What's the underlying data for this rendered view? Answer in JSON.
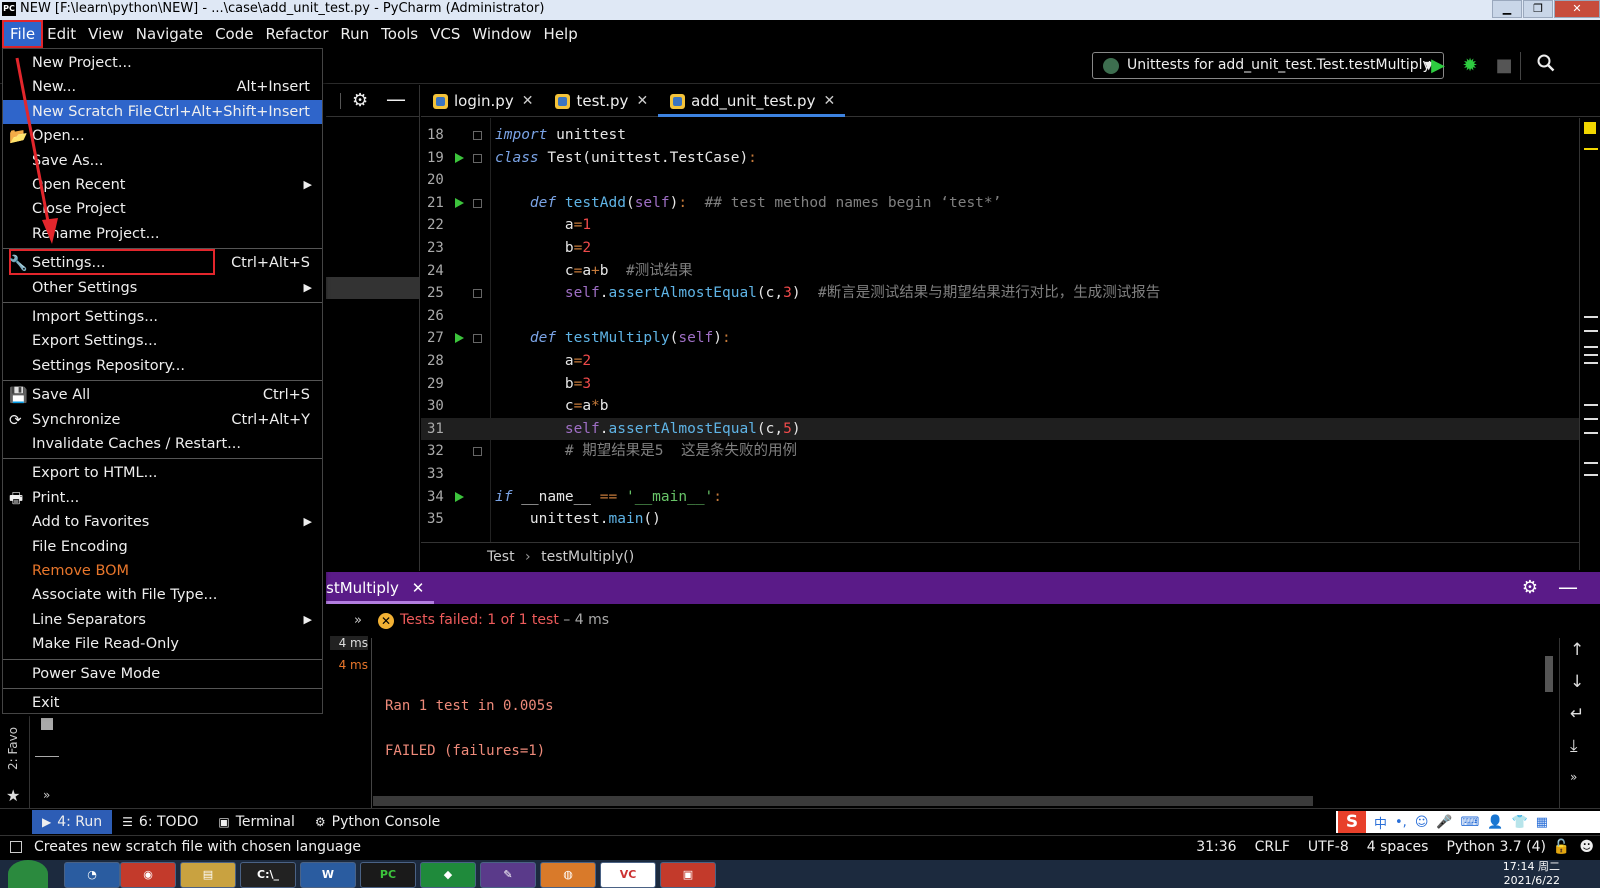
{
  "window": {
    "title": "NEW [F:\\learn\\python\\NEW] - ...\\case\\add_unit_test.py - PyCharm (Administrator)",
    "app_icon": "PC"
  },
  "menubar": [
    "File",
    "Edit",
    "View",
    "Navigate",
    "Code",
    "Refactor",
    "Run",
    "Tools",
    "VCS",
    "Window",
    "Help"
  ],
  "toolbar": {
    "run_config": "Unittests for add_unit_test.Test.testMultiply"
  },
  "tabs": [
    {
      "label": "login.py",
      "active": false
    },
    {
      "label": "test.py",
      "active": false
    },
    {
      "label": "add_unit_test.py",
      "active": true
    }
  ],
  "editor": {
    "lines": [
      {
        "n": "18",
        "html": "<span class=\"kw\">import</span> unittest",
        "run": false,
        "fold": true
      },
      {
        "n": "19",
        "html": "<span class=\"kw\">class</span> Test(unittest.TestCase)<span class=\"op\">:</span>",
        "run": true,
        "fold": true
      },
      {
        "n": "20",
        "html": "",
        "run": false,
        "fold": false
      },
      {
        "n": "21",
        "html": "    <span class=\"kw\">def</span> <span class=\"fn\">testAdd</span>(<span class=\"self\">self</span>)<span class=\"op\">:</span>  <span class=\"cmt\">## test method names begin ‘test*’</span>",
        "run": true,
        "fold": true
      },
      {
        "n": "22",
        "html": "        a<span class=\"op\">=</span><span class=\"num\">1</span>",
        "run": false,
        "fold": false
      },
      {
        "n": "23",
        "html": "        b<span class=\"op\">=</span><span class=\"num\">2</span>",
        "run": false,
        "fold": false
      },
      {
        "n": "24",
        "html": "        c<span class=\"op\">=</span>a<span class=\"op\">+</span>b  <span class=\"cmt\">#测试结果</span>",
        "run": false,
        "fold": false
      },
      {
        "n": "25",
        "html": "        <span class=\"self\">self</span>.<span class=\"fn\">assertAlmostEqual</span>(c,<span class=\"num\">3</span>)  <span class=\"cmt\">#断言是测试结果与期望结果进行对比，生成测试报告</span>",
        "run": false,
        "fold": true
      },
      {
        "n": "26",
        "html": "",
        "run": false,
        "fold": false
      },
      {
        "n": "27",
        "html": "    <span class=\"kw\">def</span> <span class=\"fn\">testMultiply</span>(<span class=\"self\">self</span>)<span class=\"op\">:</span>",
        "run": true,
        "fold": true
      },
      {
        "n": "28",
        "html": "        a<span class=\"op\">=</span><span class=\"num\">2</span>",
        "run": false,
        "fold": false
      },
      {
        "n": "29",
        "html": "        b<span class=\"op\">=</span><span class=\"num\">3</span>",
        "run": false,
        "fold": false
      },
      {
        "n": "30",
        "html": "        c<span class=\"op\">=</span>a<span class=\"op\">*</span>b",
        "run": false,
        "fold": false
      },
      {
        "n": "31",
        "html": "        <span class=\"self\">self</span>.<span class=\"fn\">assertAlmostEqual</span>(c,<span class=\"num\">5</span>)",
        "run": false,
        "fold": false,
        "current": true
      },
      {
        "n": "32",
        "html": "        <span class=\"cmt\"># 期望结果是5  这是条失败的用例</span>",
        "run": false,
        "fold": true
      },
      {
        "n": "33",
        "html": "",
        "run": false,
        "fold": false
      },
      {
        "n": "34",
        "html": "<span class=\"kw\">if</span> __name__ <span class=\"op\">==</span> <span class=\"str\">'__main__'</span><span class=\"op\">:</span>",
        "run": true,
        "fold": false
      },
      {
        "n": "35",
        "html": "    unittest.<span class=\"fn\">main</span>()",
        "run": false,
        "fold": false
      }
    ],
    "breadcrumb": [
      "Test",
      "testMultiply()"
    ]
  },
  "run_panel": {
    "tab_label": "stMultiply",
    "status": "Tests failed: 1 of 1 test",
    "duration": "– 4 ms",
    "tree_times": [
      "4 ms",
      "4 ms"
    ],
    "console": [
      "Ran 1 test in 0.005s",
      "FAILED (failures=1)"
    ]
  },
  "favorites_label": "2: Favo",
  "tool_buttons": [
    {
      "label": "4: Run",
      "icon": "▶",
      "active": true
    },
    {
      "label": "6: TODO",
      "icon": "☰",
      "active": false
    },
    {
      "label": "Terminal",
      "icon": "▣",
      "active": false
    },
    {
      "label": "Python Console",
      "icon": "⚙",
      "active": false
    }
  ],
  "statusbar": {
    "message": "Creates new scratch file with chosen language",
    "position": "31:36",
    "line_sep": "CRLF",
    "encoding": "UTF-8",
    "indent": "4 spaces",
    "interpreter": "Python 3.7 (4)"
  },
  "taskbar": {
    "time": "17:14 周二",
    "date": "2021/6/22"
  },
  "file_menu": {
    "groups": [
      [
        {
          "label": "New Project...",
          "shortcut": ""
        },
        {
          "label": "New...",
          "shortcut": "Alt+Insert"
        },
        {
          "label": "New Scratch File",
          "shortcut": "Ctrl+Alt+Shift+Insert",
          "highlight": true
        },
        {
          "label": "Open...",
          "shortcut": "",
          "icon": "📂"
        },
        {
          "label": "Save As...",
          "shortcut": ""
        },
        {
          "label": "Open Recent",
          "shortcut": "",
          "submenu": true
        },
        {
          "label": "Close Project",
          "shortcut": ""
        },
        {
          "label": "Rename Project...",
          "shortcut": ""
        }
      ],
      [
        {
          "label": "Settings...",
          "shortcut": "Ctrl+Alt+S",
          "icon": "🔧"
        },
        {
          "label": "Other Settings",
          "shortcut": "",
          "submenu": true
        }
      ],
      [
        {
          "label": "Import Settings...",
          "shortcut": ""
        },
        {
          "label": "Export Settings...",
          "shortcut": ""
        },
        {
          "label": "Settings Repository...",
          "shortcut": ""
        }
      ],
      [
        {
          "label": "Save All",
          "shortcut": "Ctrl+S",
          "icon": "💾"
        },
        {
          "label": "Synchronize",
          "shortcut": "Ctrl+Alt+Y",
          "icon": "⟳"
        },
        {
          "label": "Invalidate Caches / Restart...",
          "shortcut": ""
        }
      ],
      [
        {
          "label": "Export to HTML...",
          "shortcut": ""
        },
        {
          "label": "Print...",
          "shortcut": "",
          "icon": "🖶"
        },
        {
          "label": "Add to Favorites",
          "shortcut": "",
          "submenu": true
        },
        {
          "label": "File Encoding",
          "shortcut": ""
        },
        {
          "label": "Remove BOM",
          "shortcut": "",
          "orange": true
        },
        {
          "label": "Associate with File Type...",
          "shortcut": ""
        },
        {
          "label": "Line Separators",
          "shortcut": "",
          "submenu": true
        },
        {
          "label": "Make File Read-Only",
          "shortcut": ""
        }
      ],
      [
        {
          "label": "Power Save Mode",
          "shortcut": ""
        }
      ],
      [
        {
          "label": "Exit",
          "shortcut": ""
        }
      ]
    ]
  },
  "colors": {
    "accent": "#2f65ca",
    "annotation_red": "#e3262c",
    "run_header": "#5a1b88",
    "fail_text": "#ee5b5b"
  }
}
